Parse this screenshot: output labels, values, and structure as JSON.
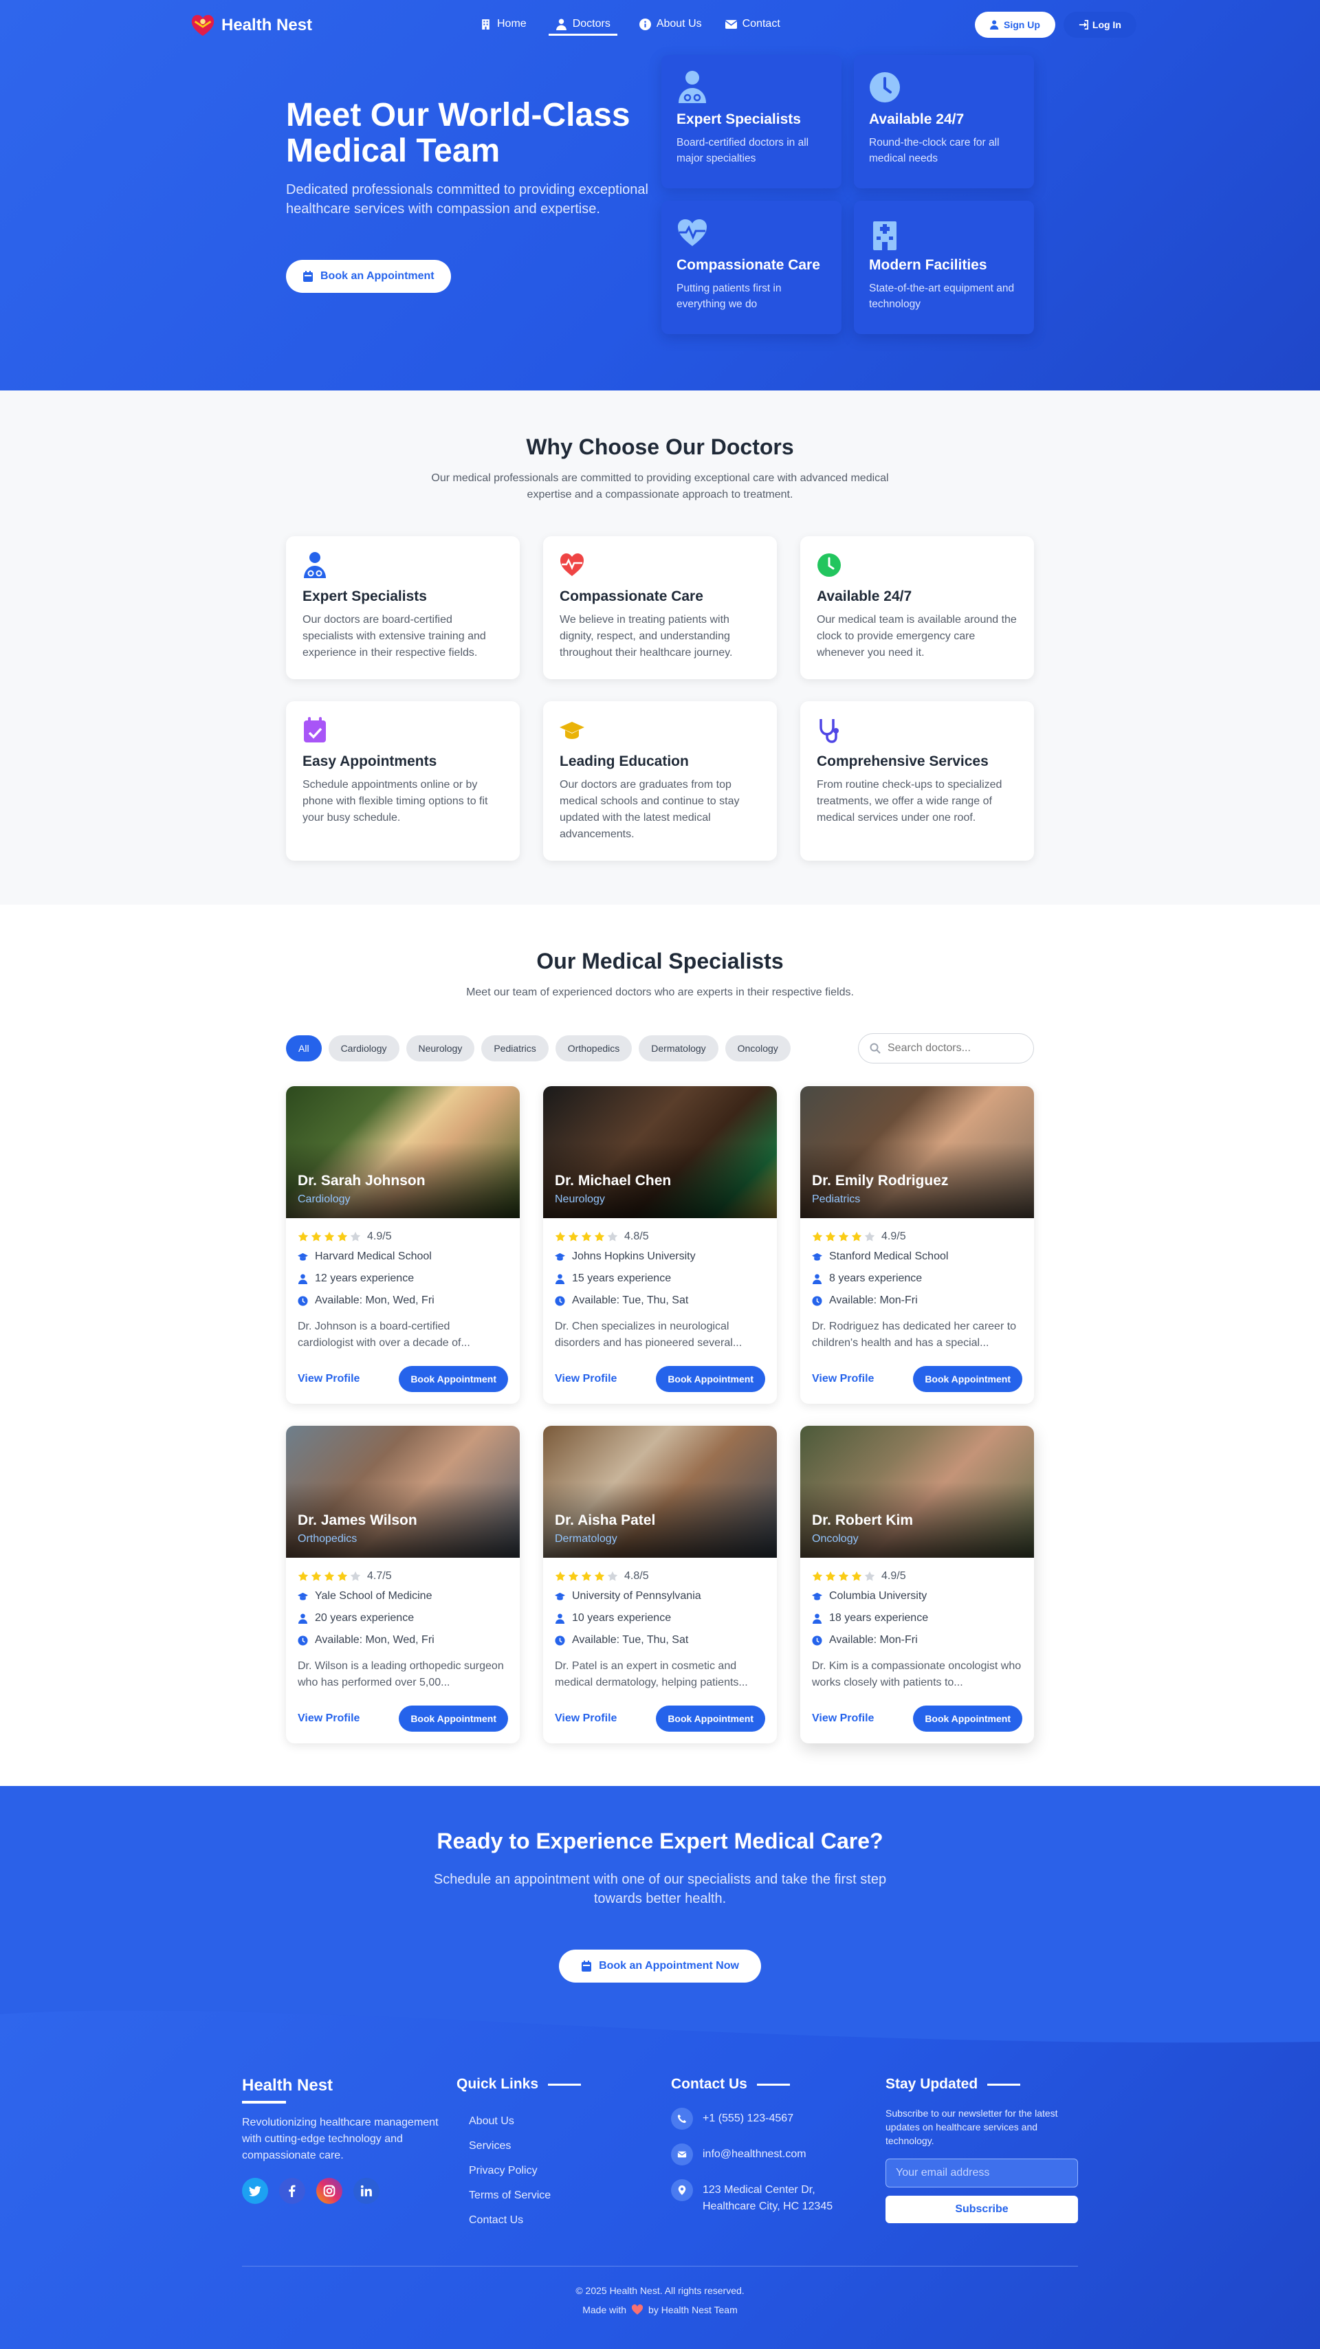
{
  "brand": {
    "name": "Health Nest"
  },
  "nav": {
    "links": [
      {
        "label": "Home",
        "icon": "home-icon"
      },
      {
        "label": "Doctors",
        "icon": "user-md-icon",
        "active": true
      },
      {
        "label": "About Us",
        "icon": "info-icon"
      },
      {
        "label": "Contact",
        "icon": "envelope-icon"
      }
    ],
    "signup": "Sign Up",
    "login": "Log In"
  },
  "hero": {
    "title": "Meet Our World-Class Medical Team",
    "subtitle": "Dedicated professionals committed to providing exceptional healthcare services with compassion and expertise.",
    "cta": "Book an Appointment",
    "cards": [
      {
        "title": "Expert Specialists",
        "text": "Board-certified doctors in all major specialties",
        "icon": "doctor-icon"
      },
      {
        "title": "Available 24/7",
        "text": "Round-the-clock care for all medical needs",
        "icon": "clock-icon"
      },
      {
        "title": "Compassionate Care",
        "text": "Putting patients first in everything we do",
        "icon": "heartbeat-icon"
      },
      {
        "title": "Modern Facilities",
        "text": "State-of-the-art equipment and technology",
        "icon": "hospital-icon"
      }
    ]
  },
  "why": {
    "title": "Why Choose Our Doctors",
    "subtitle": "Our medical professionals are committed to providing exceptional care with advanced medical expertise and a compassionate approach to treatment.",
    "cards": [
      {
        "title": "Expert Specialists",
        "text": "Our doctors are board-certified specialists with extensive training and experience in their respective fields.",
        "icon": "doctor-icon",
        "color": "#2563eb"
      },
      {
        "title": "Compassionate Care",
        "text": "We believe in treating patients with dignity, respect, and understanding throughout their healthcare journey.",
        "icon": "heartbeat-icon",
        "color": "#ef4444"
      },
      {
        "title": "Available 24/7",
        "text": "Our medical team is available around the clock to provide emergency care whenever you need it.",
        "icon": "clock-icon",
        "color": "#22c55e"
      },
      {
        "title": "Easy Appointments",
        "text": "Schedule appointments online or by phone with flexible timing options to fit your busy schedule.",
        "icon": "calendar-check-icon",
        "color": "#a855f7"
      },
      {
        "title": "Leading Education",
        "text": "Our doctors are graduates from top medical schools and continue to stay updated with the latest medical advancements.",
        "icon": "graduation-cap-icon",
        "color": "#eab308"
      },
      {
        "title": "Comprehensive Services",
        "text": "From routine check-ups to specialized treatments, we offer a wide range of medical services under one roof.",
        "icon": "stethoscope-icon",
        "color": "#4f46e5"
      }
    ]
  },
  "specialists": {
    "title": "Our Medical Specialists",
    "subtitle": "Meet our team of experienced doctors who are experts in their respective fields.",
    "filters": [
      "All",
      "Cardiology",
      "Neurology",
      "Pediatrics",
      "Orthopedics",
      "Dermatology",
      "Oncology"
    ],
    "search_placeholder": "Search doctors...",
    "view_label": "View Profile",
    "book_label": "Book Appointment",
    "doctors": [
      {
        "name": "Dr. Sarah Johnson",
        "specialty": "Cardiology",
        "rating": "4.9/5",
        "stars": 4,
        "school": "Harvard Medical School",
        "experience": "12 years experience",
        "availability": "Available: Mon, Wed, Fri",
        "desc": "Dr. Johnson is a board-certified cardiologist with over a decade of..."
      },
      {
        "name": "Dr. Michael Chen",
        "specialty": "Neurology",
        "rating": "4.8/5",
        "stars": 4,
        "school": "Johns Hopkins University",
        "experience": "15 years experience",
        "availability": "Available: Tue, Thu, Sat",
        "desc": "Dr. Chen specializes in neurological disorders and has pioneered several..."
      },
      {
        "name": "Dr. Emily Rodriguez",
        "specialty": "Pediatrics",
        "rating": "4.9/5",
        "stars": 4,
        "school": "Stanford Medical School",
        "experience": "8 years experience",
        "availability": "Available: Mon-Fri",
        "desc": "Dr. Rodriguez has dedicated her career to children's health and has a special..."
      },
      {
        "name": "Dr. James Wilson",
        "specialty": "Orthopedics",
        "rating": "4.7/5",
        "stars": 4,
        "school": "Yale School of Medicine",
        "experience": "20 years experience",
        "availability": "Available: Mon, Wed, Fri",
        "desc": "Dr. Wilson is a leading orthopedic surgeon who has performed over 5,00..."
      },
      {
        "name": "Dr. Aisha Patel",
        "specialty": "Dermatology",
        "rating": "4.8/5",
        "stars": 4,
        "school": "University of Pennsylvania",
        "experience": "10 years experience",
        "availability": "Available: Tue, Thu, Sat",
        "desc": "Dr. Patel is an expert in cosmetic and medical dermatology, helping patients..."
      },
      {
        "name": "Dr. Robert Kim",
        "specialty": "Oncology",
        "rating": "4.9/5",
        "stars": 4,
        "school": "Columbia University",
        "experience": "18 years experience",
        "availability": "Available: Mon-Fri",
        "desc": "Dr. Kim is a compassionate oncologist who works closely with patients to..."
      }
    ]
  },
  "cta": {
    "title": "Ready to Experience Expert Medical Care?",
    "subtitle": "Schedule an appointment with one of our specialists and take the first step towards better health.",
    "button": "Book an Appointment Now"
  },
  "footer": {
    "brand": "Health Nest",
    "tagline": "Revolutionizing healthcare management with cutting-edge technology and compassionate care.",
    "socials": [
      "twitter-icon",
      "facebook-icon",
      "instagram-icon",
      "linkedin-icon"
    ],
    "quick_title": "Quick Links",
    "quick_links": [
      "About Us",
      "Services",
      "Privacy Policy",
      "Terms of Service",
      "Contact Us"
    ],
    "contact_title": "Contact Us",
    "phone": "+1 (555) 123-4567",
    "email": "info@healthnest.com",
    "address": "123 Medical Center Dr, Healthcare City, HC 12345",
    "news_title": "Stay Updated",
    "news_text": "Subscribe to our newsletter for the latest updates on healthcare services and technology.",
    "news_placeholder": "Your email address",
    "news_button": "Subscribe",
    "copyright": "© 2025 Health Nest. All rights reserved.",
    "made_prefix": "Made with",
    "made_suffix": "by Health Nest Team"
  }
}
